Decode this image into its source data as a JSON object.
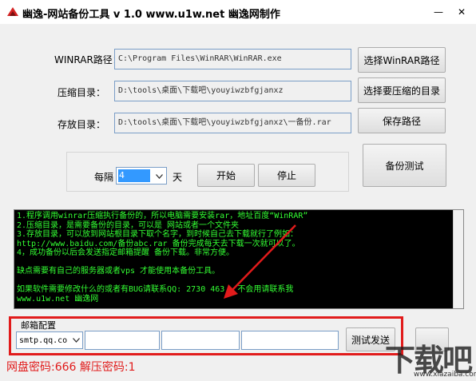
{
  "window": {
    "title": "幽逸-网站备份工具 v 1.0 www.u1w.net 幽逸网制作",
    "minimize": "—",
    "close": "✕"
  },
  "paths": {
    "winrar_label": "WINRAR路径：",
    "winrar_value": "C:\\Program Files\\WinRAR\\WinRAR.exe",
    "winrar_button": "选择WinRAR路径",
    "compress_label": "压缩目录：",
    "compress_value": "D:\\tools\\桌面\\下载吧\\youyiwzbfgjanxz",
    "compress_button": "选择要压缩的目录",
    "store_label": "存放目录：",
    "store_value": "D:\\tools\\桌面\\下载吧\\youyiwzbfgjanxz\\一备份.rar",
    "store_button": "保存路径"
  },
  "schedule": {
    "every_label": "每隔",
    "interval_value": "4",
    "unit_label": "天",
    "start_button": "开始",
    "stop_button": "停止",
    "test_button": "备份测试"
  },
  "console": {
    "lines": [
      "1.程序调用winrar压缩执行备份的，所以电脑需要安装rar，地址百度“WinRAR”",
      "2.压缩目录，是需要备份的目录，可以是 网站或者一个文件夹",
      "3.存放目录，可以放到网站根目录下取个名字，到时候自己去下载就行了例如：",
      "http://www.baidu.com/备份abc.rar 备份完成每天去下载一次就可以了。",
      "4，成功备份以后会发送指定邮箱提醒 备份下载。非常方便。",
      "",
      " 缺点需要有自己的服务器或者vps 才能使用本备份工具。",
      "",
      "如果软件需要修改什么的或者有BUG请联系QQ: 2730 463 ，不会用请联系我",
      "www.u1w.net 幽逸网"
    ]
  },
  "mail": {
    "legend": "邮箱配置",
    "smtp_value": "smtp.qq.co",
    "test_button": "测试发送"
  },
  "footer": {
    "password_text": "网盘密码:666 解压密码:1"
  },
  "watermark": {
    "logo_text": "下载吧",
    "url": "www.xiazaiba.com"
  },
  "colors": {
    "console_text": "#33ff33",
    "highlight_red": "#e11b1b",
    "interval_selected": "#3399ff"
  }
}
